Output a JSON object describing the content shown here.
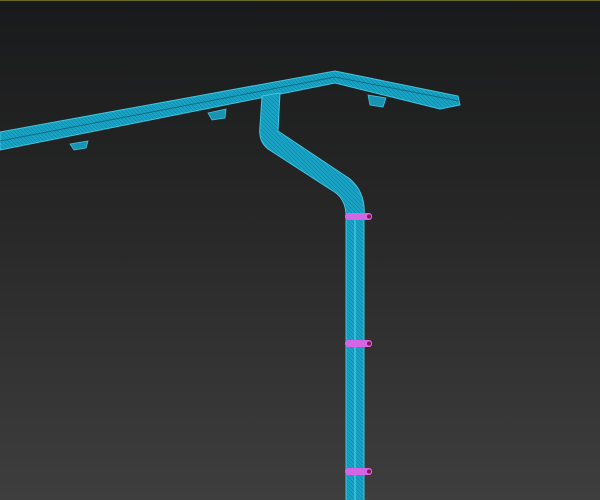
{
  "viewport": {
    "background_top": "#191a1b",
    "background_bottom": "#3e3e3e",
    "border_color": "#6b6b2a"
  },
  "model": {
    "wire_color": "#1aa3c4",
    "wire_highlight": "#3fc6e0",
    "clamp_color": "#d466e6",
    "clamp_bolt_color": "#8a1050",
    "clamp_count": 3
  }
}
